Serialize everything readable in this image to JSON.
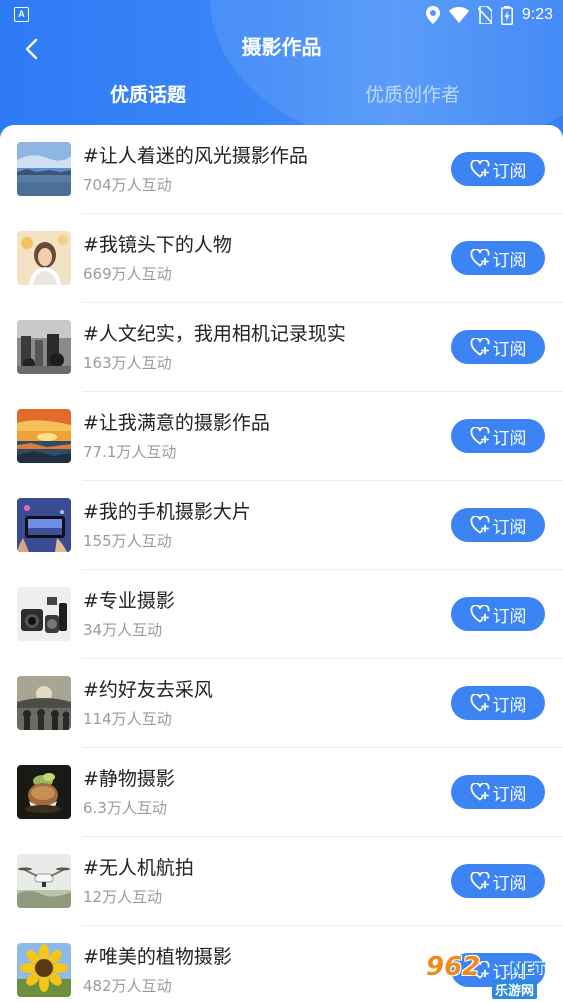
{
  "status_bar": {
    "notification_icon": "A",
    "time": "9:23"
  },
  "header": {
    "title": "摄影作品",
    "back_icon": "chevron-left-icon"
  },
  "tabs": [
    {
      "label": "优质话题",
      "active": true
    },
    {
      "label": "优质创作者",
      "active": false
    }
  ],
  "subscribe_label": "订阅",
  "topics": [
    {
      "title": "#让人着迷的风光摄影作品",
      "interactions": "704万人互动",
      "thumb": "landscape"
    },
    {
      "title": "#我镜头下的人物",
      "interactions": "669万人互动",
      "thumb": "portrait"
    },
    {
      "title": "#人文纪实，我用相机记录现实",
      "interactions": "163万人互动",
      "thumb": "street"
    },
    {
      "title": "#让我满意的摄影作品",
      "interactions": "77.1万人互动",
      "thumb": "sunset"
    },
    {
      "title": "#我的手机摄影大片",
      "interactions": "155万人互动",
      "thumb": "phone"
    },
    {
      "title": "#专业摄影",
      "interactions": "34万人互动",
      "thumb": "camera"
    },
    {
      "title": "#约好友去采风",
      "interactions": "114万人互动",
      "thumb": "friends"
    },
    {
      "title": "#静物摄影",
      "interactions": "6.3万人互动",
      "thumb": "stilllife"
    },
    {
      "title": "#无人机航拍",
      "interactions": "12万人互动",
      "thumb": "drone"
    },
    {
      "title": "#唯美的植物摄影",
      "interactions": "482万人互动",
      "thumb": "sunflower"
    }
  ],
  "watermark": {
    "number": "962",
    "domain": ".NET",
    "site": "乐游网"
  },
  "colors": {
    "primary": "#2f7cf6",
    "button": "#3c83f3",
    "subtext": "#9a9a9a"
  }
}
